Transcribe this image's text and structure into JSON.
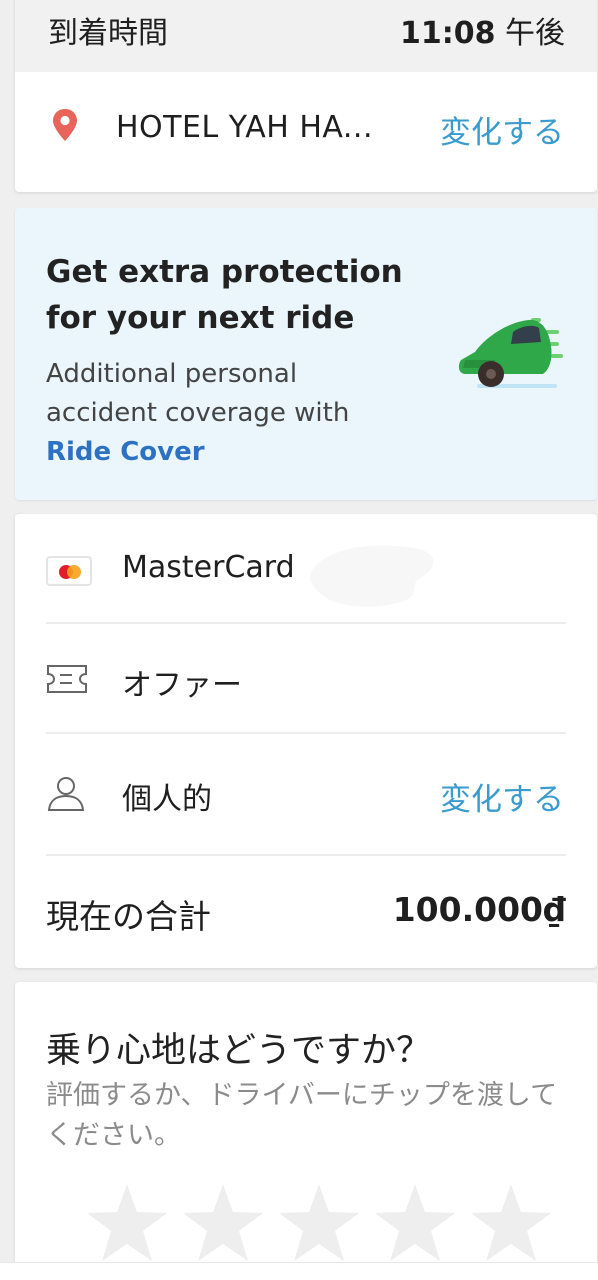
{
  "arrival": {
    "label": "到着時間",
    "time": "11:08",
    "period": "午後"
  },
  "destination": {
    "name": "HOTEL YAH HA...",
    "change_label": "変化する",
    "icon": "location-pin-icon"
  },
  "promo": {
    "title": "Get extra protection for your next ride",
    "description": "Additional personal accident coverage with",
    "link_label": "Ride Cover",
    "illustration": "green-car-illustration"
  },
  "payment": {
    "method_label": "MasterCard ",
    "method_icon": "mastercard-icon",
    "offer_label": "オファー",
    "offer_icon": "ticket-icon",
    "profile_label": "個人的",
    "profile_icon": "person-icon",
    "profile_change_label": "変化する",
    "total_label": "現在の合計",
    "total_value": "100.000₫"
  },
  "rating": {
    "title": "乗り心地はどうですか？",
    "subtitle": "評価するか、ドライバーにチップを渡してください。",
    "stars": 0
  },
  "colors": {
    "accent": "#3a9bcf",
    "promo_bg": "#eaf5fc",
    "promo_link": "#2d72c2",
    "pin": "#e8645a"
  }
}
